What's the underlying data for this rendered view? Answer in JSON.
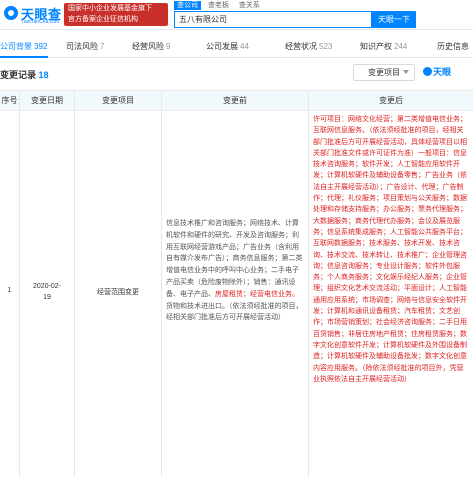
{
  "header": {
    "logo_text": "天眼查",
    "logo_sub": "TianYanCha.com",
    "banner_line1": "国家中小企业发展基金旗下",
    "banner_line2": "官方备案企业征信机构",
    "search_tabs": [
      "查公司",
      "查老板",
      "查关系"
    ],
    "search_value": "五八有限公司",
    "search_button": "天眼一下"
  },
  "nav": {
    "items": [
      {
        "label": "公司背景",
        "count": "392"
      },
      {
        "label": "司法风险",
        "count": "7"
      },
      {
        "label": "经营风险",
        "count": "9"
      },
      {
        "label": "公司发展",
        "count": "44"
      },
      {
        "label": "经营状况",
        "count": "523"
      },
      {
        "label": "知识产权",
        "count": "244"
      },
      {
        "label": "历史信息",
        "count": ""
      }
    ]
  },
  "section": {
    "title": "变更记录",
    "count": "18",
    "filter_label": "变更项目",
    "watermark": "天眼"
  },
  "table": {
    "headers": [
      "序号",
      "变更日期",
      "变更项目",
      "变更前",
      "变更后"
    ],
    "row": {
      "index": "1",
      "date_line1": "2020-02-",
      "date_line2": "19",
      "item": "经营范围变更",
      "before_parts": [
        "信息技术推广和咨询服务；网络技术、计算机软件和硬件的研究、开发及咨询服务；利用互联网经营游戏产品；广告业务（含利用自有媒介发布广告）；商务信息服务；第二类增值电信业务中的呼叫中心业务；二手电子产品买卖（危险废物除外）；销售：通讯设备、电子产品、",
        "房屋租赁；经营电信业务。",
        "货物和技术进出口。（依法须经批准的项目，经相关部门批准后方可开展经营活动）"
      ],
      "after_text": "许可项目：网络文化经营；第二类增值电信业务；互联网信息服务。（依法须经批准的项目，经相关部门批准后方可开展经营活动，具体经营项目以相关部门批准文件或许可证件为准）一般项目：信息技术咨询服务；软件开发；人工智能应用软件开发；计算机软硬件及辅助设备零售；广告业务（依法自主开展经营活动）；广告设计、代理；广告制作；代理；礼仪服务；项目策划与公关服务；数据处理和存储支持服务；办公服务；票务代理服务；大数据服务；商务代理代办服务；会议及展览服务；信息系统集成服务；人工智能公共服务平台；互联网数据服务；技术服务、技术开发、技术咨询、技术交流、技术转让、技术推广；企业管理咨询；信息咨询服务；专业设计服务；软件外包服务；个人商务服务；文化娱乐经纪人服务；企业管理；组织文化艺术交流活动；平面设计；人工智能通用应用系统；市场调查；网络与信息安全软件开发；计算机和通讯设备租赁；汽车租赁；文艺创作；市场营销策划；社会经济咨询服务；二手日用百货销售；非居住房地产租赁；住房租赁服务；数字文化创意软件开发；计算机软硬件及外围设备制造；计算机软硬件及辅助设备批发；数字文化创意内容应用服务。（除依法须经批准的项目外，凭营业执照依法自主开展经营活动）"
    }
  }
}
